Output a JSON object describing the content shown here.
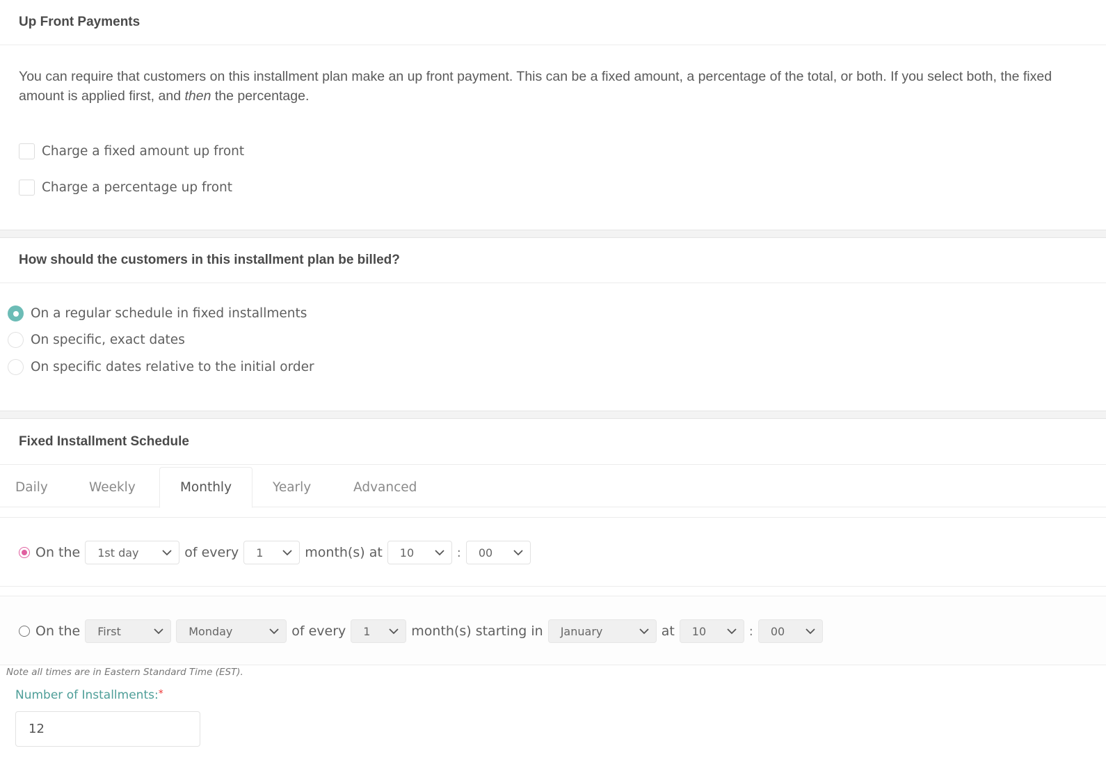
{
  "upfront": {
    "title": "Up Front Payments",
    "description_before": "You can require that customers on this installment plan make an up front payment. This can be a fixed amount, a percentage of the total, or both. If you select both, the fixed amount is applied first, and ",
    "description_emphasis": "then",
    "description_after": " the percentage.",
    "options": [
      {
        "label": "Charge a fixed amount up front",
        "checked": false
      },
      {
        "label": "Charge a percentage up front",
        "checked": false
      }
    ]
  },
  "billing": {
    "title": "How should the customers in this installment plan be billed?",
    "options": [
      {
        "label": "On a regular schedule in fixed installments",
        "selected": true
      },
      {
        "label": "On specific, exact dates",
        "selected": false
      },
      {
        "label": "On specific dates relative to the initial order",
        "selected": false
      }
    ],
    "accent_color": "#6cbcb6"
  },
  "schedule": {
    "title": "Fixed Installment Schedule",
    "tabs": [
      {
        "label": "Daily",
        "active": false
      },
      {
        "label": "Weekly",
        "active": false
      },
      {
        "label": "Monthly",
        "active": true
      },
      {
        "label": "Yearly",
        "active": false
      },
      {
        "label": "Advanced",
        "active": false
      }
    ],
    "option1": {
      "selected": true,
      "on_the": "On the",
      "day_value": "1st day",
      "of_every": "of every",
      "interval_value": "1",
      "months_at": "month(s) at",
      "hour_value": "10",
      "colon": ":",
      "minute_value": "00"
    },
    "option2": {
      "selected": false,
      "on_the": "On the",
      "ordinal_value": "First",
      "weekday_value": "Monday",
      "of_every": "of every",
      "interval_value": "1",
      "months_starting_in": "month(s) starting in",
      "month_value": "January",
      "at": "at",
      "hour_value": "10",
      "colon": ":",
      "minute_value": "00"
    },
    "radio_color": "#e060a0",
    "timezone_note": "Note all times are in Eastern Standard Time (EST).",
    "installments_label": "Number of Installments:",
    "required_mark": "*",
    "installments_value": "12"
  }
}
